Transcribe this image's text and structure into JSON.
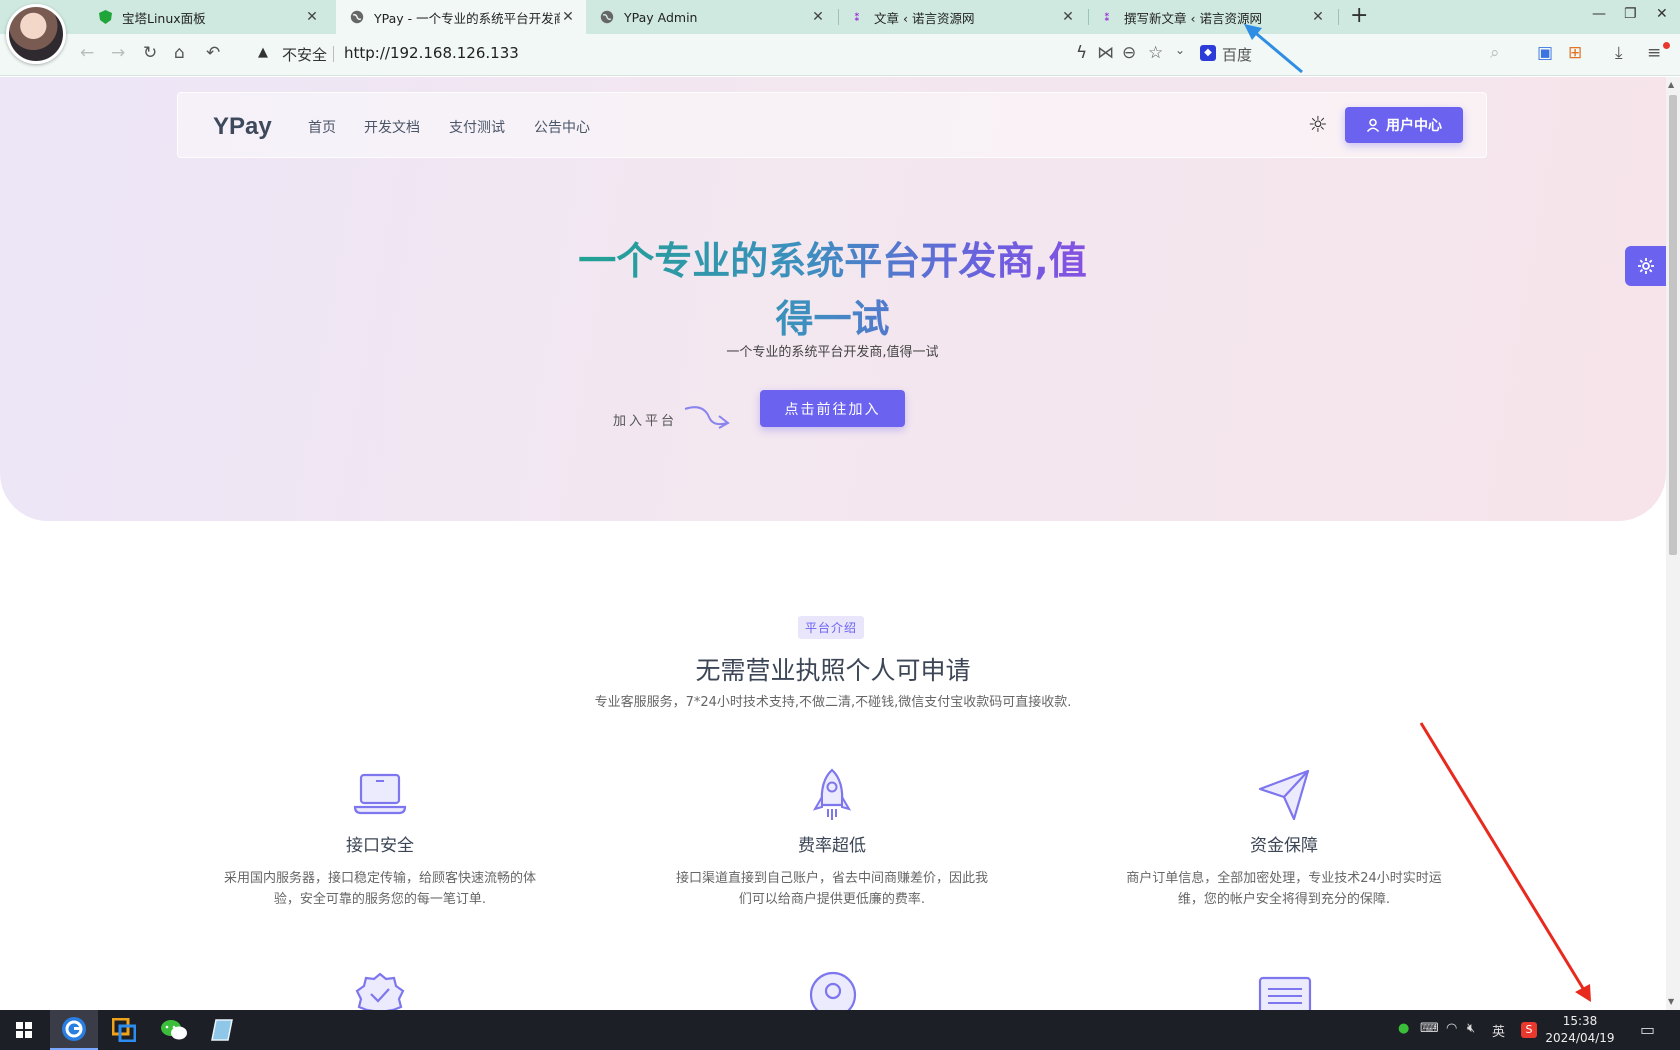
{
  "browser": {
    "tabs": [
      {
        "title": "宝塔Linux面板",
        "favicon": "shield-icon"
      },
      {
        "title": "YPay - 一个专业的系统平台开发商,值得一试",
        "favicon": "globe-icon"
      },
      {
        "title": "YPay Admin",
        "favicon": "globe-icon"
      },
      {
        "title": "文章 ‹ 诺言资源网",
        "favicon": "site-logo-icon"
      },
      {
        "title": "撰写新文章 ‹ 诺言资源网",
        "favicon": "site-logo-icon"
      }
    ],
    "security_label": "不安全",
    "url": "http://192.168.126.133",
    "search_engine": "百度",
    "colors": {
      "tab_bar": "#cfe9e0",
      "toolbar": "#f1f8f5"
    }
  },
  "site": {
    "brand": "YPay",
    "nav": [
      "首页",
      "开发文档",
      "支付测试",
      "公告中心"
    ],
    "user_center": "用户中心",
    "hero": {
      "title": "一个专业的系统平台开发商,值得一试",
      "subtitle": "一个专业的系统平台开发商,值得一试",
      "join_label": "加入平台",
      "join_button": "点击前往加入"
    },
    "section": {
      "badge": "平台介绍",
      "title": "无需营业执照个人可申请",
      "description": "专业客服服务，7*24小时技术支持,不做二清,不碰钱,微信支付宝收款码可直接收款."
    },
    "features": [
      {
        "icon": "laptop-icon",
        "title": "接口安全",
        "desc": "采用国内服务器，接口稳定传输，给顾客快速流畅的体验，安全可靠的服务您的每一笔订单."
      },
      {
        "icon": "rocket-icon",
        "title": "费率超低",
        "desc": "接口渠道直接到自己账户，省去中间商赚差价，因此我们可以给商户提供更低廉的费率."
      },
      {
        "icon": "paper-plane-icon",
        "title": "资金保障",
        "desc": "商户订单信息，全部加密处理，专业技术24小时实时运维，您的帐户安全将得到充分的保障."
      }
    ],
    "accent_color": "#6b63f0"
  },
  "taskbar": {
    "time": "15:38",
    "date": "2024/04/19",
    "ime": "英"
  }
}
